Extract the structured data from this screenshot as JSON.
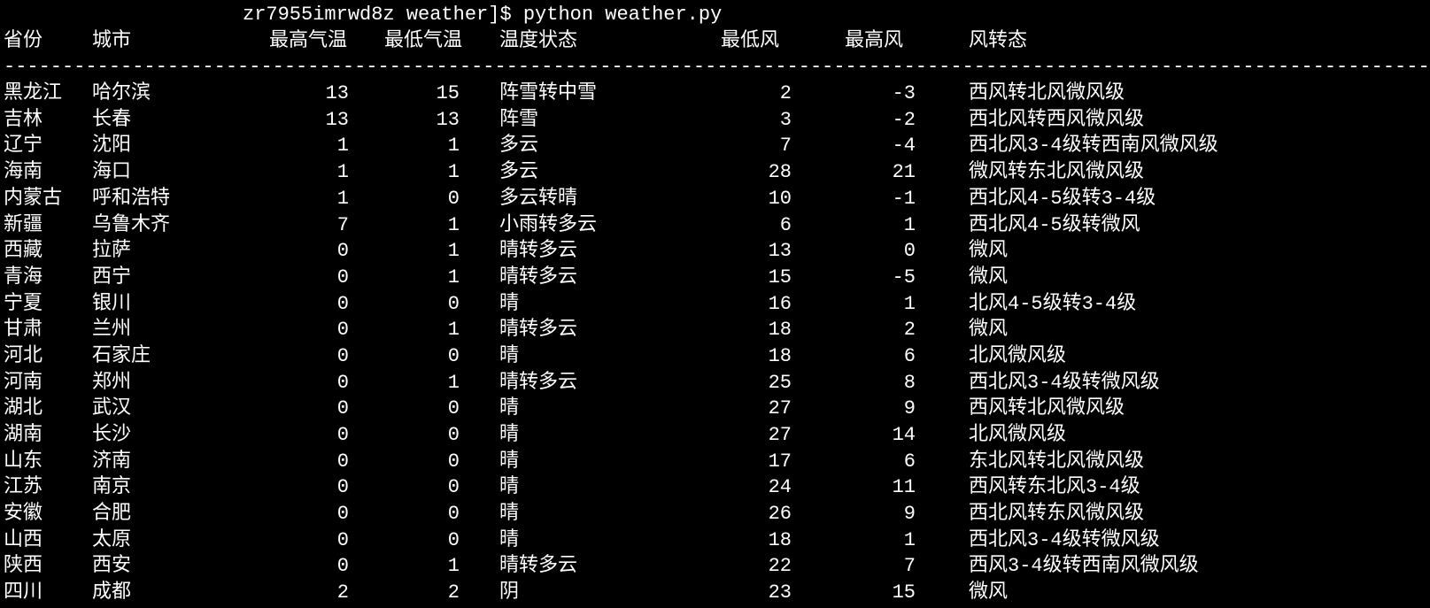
{
  "prompt": "zr7955imrwd8z weather]$ python weather.py",
  "headers": {
    "province": "省份",
    "city": "城市",
    "high_temp": "最高气温",
    "low_temp": "最低气温",
    "temp_status": "温度状态",
    "min_wind": "最低风",
    "max_wind": "最高风",
    "wind_change": "风转态"
  },
  "separator": "----------------------------------------------------------------------------------------------------------------------------------",
  "rows": [
    {
      "province": "黑龙江",
      "city": "哈尔滨",
      "high": "13",
      "low": "15",
      "status": "阵雪转中雪",
      "minw": "2",
      "maxw": "-3",
      "wind": "西风转北风微风级"
    },
    {
      "province": "吉林",
      "city": "长春",
      "high": "13",
      "low": "13",
      "status": "阵雪",
      "minw": "3",
      "maxw": "-2",
      "wind": "西北风转西风微风级"
    },
    {
      "province": "辽宁",
      "city": "沈阳",
      "high": "1",
      "low": "1",
      "status": "多云",
      "minw": "7",
      "maxw": "-4",
      "wind": "西北风3-4级转西南风微风级"
    },
    {
      "province": "海南",
      "city": "海口",
      "high": "1",
      "low": "1",
      "status": "多云",
      "minw": "28",
      "maxw": "21",
      "wind": "微风转东北风微风级"
    },
    {
      "province": "内蒙古",
      "city": "呼和浩特",
      "high": "1",
      "low": "0",
      "status": "多云转晴",
      "minw": "10",
      "maxw": "-1",
      "wind": "西北风4-5级转3-4级"
    },
    {
      "province": "新疆",
      "city": "乌鲁木齐",
      "high": "7",
      "low": "1",
      "status": "小雨转多云",
      "minw": "6",
      "maxw": "1",
      "wind": "西北风4-5级转微风"
    },
    {
      "province": "西藏",
      "city": "拉萨",
      "high": "0",
      "low": "1",
      "status": "晴转多云",
      "minw": "13",
      "maxw": "0",
      "wind": "微风"
    },
    {
      "province": "青海",
      "city": "西宁",
      "high": "0",
      "low": "1",
      "status": "晴转多云",
      "minw": "15",
      "maxw": "-5",
      "wind": "微风"
    },
    {
      "province": "宁夏",
      "city": "银川",
      "high": "0",
      "low": "0",
      "status": "晴",
      "minw": "16",
      "maxw": "1",
      "wind": "北风4-5级转3-4级"
    },
    {
      "province": "甘肃",
      "city": "兰州",
      "high": "0",
      "low": "1",
      "status": "晴转多云",
      "minw": "18",
      "maxw": "2",
      "wind": "微风"
    },
    {
      "province": "河北",
      "city": "石家庄",
      "high": "0",
      "low": "0",
      "status": "晴",
      "minw": "18",
      "maxw": "6",
      "wind": "北风微风级"
    },
    {
      "province": "河南",
      "city": "郑州",
      "high": "0",
      "low": "1",
      "status": "晴转多云",
      "minw": "25",
      "maxw": "8",
      "wind": "西北风3-4级转微风级"
    },
    {
      "province": "湖北",
      "city": "武汉",
      "high": "0",
      "low": "0",
      "status": "晴",
      "minw": "27",
      "maxw": "9",
      "wind": "西风转北风微风级"
    },
    {
      "province": "湖南",
      "city": "长沙",
      "high": "0",
      "low": "0",
      "status": "晴",
      "minw": "27",
      "maxw": "14",
      "wind": "北风微风级"
    },
    {
      "province": "山东",
      "city": "济南",
      "high": "0",
      "low": "0",
      "status": "晴",
      "minw": "17",
      "maxw": "6",
      "wind": "东北风转北风微风级"
    },
    {
      "province": "江苏",
      "city": "南京",
      "high": "0",
      "low": "0",
      "status": "晴",
      "minw": "24",
      "maxw": "11",
      "wind": "西风转东北风3-4级"
    },
    {
      "province": "安徽",
      "city": "合肥",
      "high": "0",
      "low": "0",
      "status": "晴",
      "minw": "26",
      "maxw": "9",
      "wind": "西北风转东风微风级"
    },
    {
      "province": "山西",
      "city": "太原",
      "high": "0",
      "low": "0",
      "status": "晴",
      "minw": "18",
      "maxw": "1",
      "wind": "西北风3-4级转微风级"
    },
    {
      "province": "陕西",
      "city": "西安",
      "high": "0",
      "low": "1",
      "status": "晴转多云",
      "minw": "22",
      "maxw": "7",
      "wind": "西风3-4级转西南风微风级"
    },
    {
      "province": "四川",
      "city": "成都",
      "high": "2",
      "low": "2",
      "status": "阴",
      "minw": "23",
      "maxw": "15",
      "wind": "微风"
    }
  ]
}
